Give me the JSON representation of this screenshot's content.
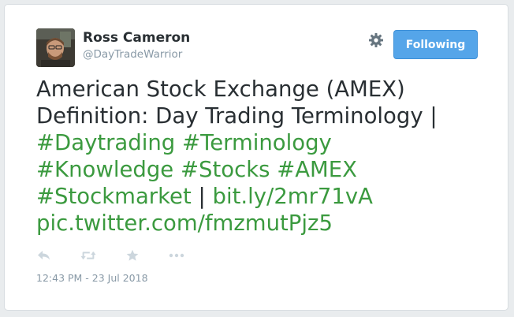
{
  "user": {
    "name": "Ross Cameron",
    "handle": "@DayTradeWarrior"
  },
  "header": {
    "follow_label": "Following",
    "settings_icon": "gear-icon"
  },
  "tweet": {
    "line1": "American Stock Exchange (AMEX)",
    "line2": "Definition: Day Trading Terminology |",
    "hashtags": {
      "daytrading": "#Daytrading",
      "terminology": "#Terminology",
      "knowledge": "#Knowledge",
      "stocks": "#Stocks",
      "amex": "#AMEX",
      "stockmarket": "#Stockmarket"
    },
    "separator": "|",
    "short_link": "bit.ly/2mr71vA",
    "pic_link": "pic.twitter.com/fmzmutPjz5"
  },
  "actions": {
    "icons": [
      "reply-icon",
      "retweet-icon",
      "favorite-icon",
      "more-icon"
    ]
  },
  "timestamp": "12:43 PM - 23 Jul 2018",
  "colors": {
    "link_green": "#3b9a3f",
    "button_blue": "#55a5e9",
    "text_dark": "#292f33",
    "text_gray": "#8899a6"
  }
}
